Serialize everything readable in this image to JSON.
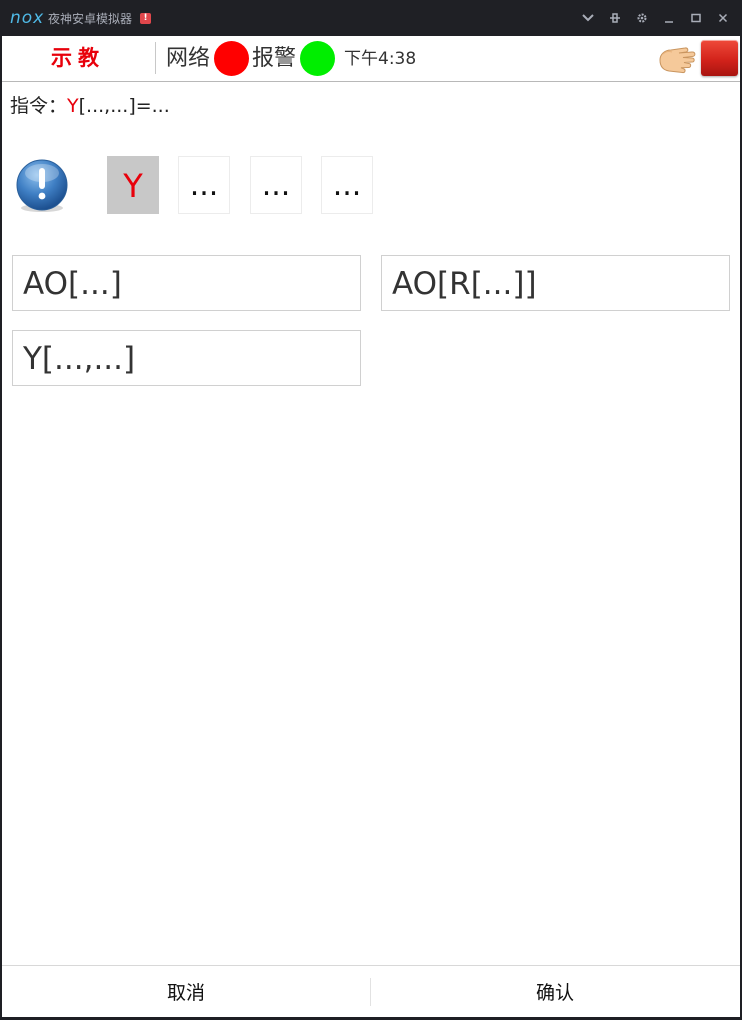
{
  "window": {
    "logo": "nox",
    "title": "夜神安卓模拟器",
    "alert_badge": "!"
  },
  "topbar": {
    "mode_title": "示教",
    "network_label": "网络",
    "network_status_color": "#ff0000",
    "alarm_label": "报警",
    "alarm_status_color": "#00ee00",
    "clock": "下午4:38"
  },
  "command": {
    "label": "指令：",
    "prefix": "Y",
    "rest": "[...,...]=..."
  },
  "tokens": [
    {
      "text": "Y",
      "selected": true
    },
    {
      "text": "...",
      "selected": false
    },
    {
      "text": "...",
      "selected": false
    },
    {
      "text": "...",
      "selected": false
    }
  ],
  "options": [
    {
      "label": "AO[...]"
    },
    {
      "label": "AO[R[...]]"
    },
    {
      "label": "Y[...,...]"
    }
  ],
  "bottom": {
    "cancel": "取消",
    "confirm": "确认"
  },
  "colors": {
    "accent_red": "#e8000b",
    "selected_token_bg": "#c8c8c8",
    "titlebar_bg": "#1f2025"
  }
}
